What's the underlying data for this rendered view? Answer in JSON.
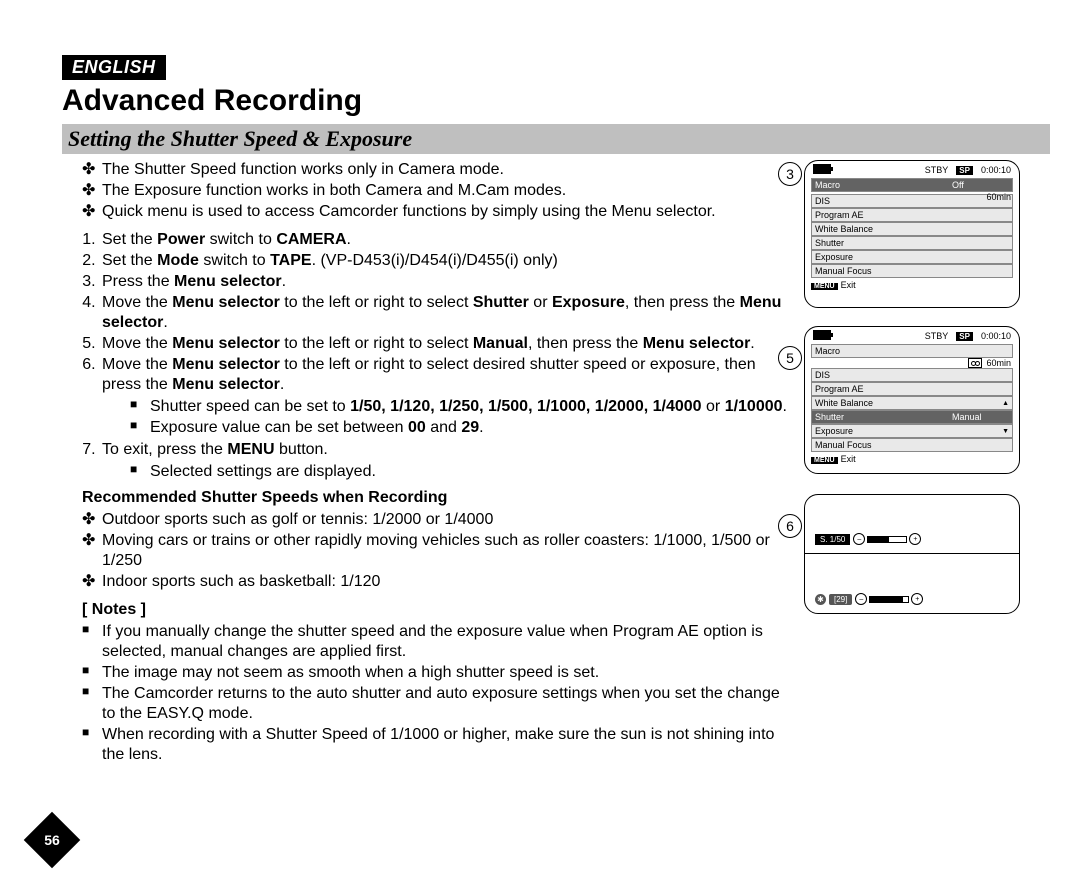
{
  "lang_tab": "ENGLISH",
  "title": "Advanced Recording",
  "section": "Setting the Shutter Speed & Exposure",
  "intro": [
    "The Shutter Speed function works only in Camera mode.",
    "The Exposure function works in both Camera and M.Cam modes.",
    "Quick menu is used to access Camcorder functions by simply using the Menu selector."
  ],
  "steps": {
    "s1_a": "Set the ",
    "s1_b": "Power",
    "s1_c": " switch to ",
    "s1_d": "CAMERA",
    "s1_e": ".",
    "s2_a": "Set the ",
    "s2_b": "Mode",
    "s2_c": " switch to ",
    "s2_d": "TAPE",
    "s2_e": ". (VP-D453(i)/D454(i)/D455(i) only)",
    "s3_a": "Press the ",
    "s3_b": "Menu selector",
    "s3_c": ".",
    "s4_a": "Move the ",
    "s4_b": "Menu selector",
    "s4_c": " to the left or right to select ",
    "s4_d": "Shutter",
    "s4_e": " or ",
    "s4_f": "Exposure",
    "s4_g": ", then press the ",
    "s4_h": "Menu selector",
    "s4_i": ".",
    "s5_a": "Move the ",
    "s5_b": "Menu selector",
    "s5_c": " to the left or right to select ",
    "s5_d": "Manual",
    "s5_e": ", then press the ",
    "s5_f": "Menu selector",
    "s5_g": ".",
    "s6_a": "Move the ",
    "s6_b": "Menu selector",
    "s6_c": " to the left or right to select desired shutter speed or exposure, then press the ",
    "s6_d": "Menu selector",
    "s6_e": ".",
    "s6_sub1_a": "Shutter speed can be set to ",
    "s6_sub1_vals": "1/50, 1/120, 1/250, 1/500, 1/1000, 1/2000, 1/4000",
    "s6_sub1_b": " or ",
    "s6_sub1_last": "1/10000",
    "s6_sub1_c": ".",
    "s6_sub2_a": "Exposure value can be set between ",
    "s6_sub2_v1": "00",
    "s6_sub2_b": " and ",
    "s6_sub2_v2": "29",
    "s6_sub2_c": ".",
    "s7_a": "To exit, press the ",
    "s7_b": "MENU",
    "s7_c": " button.",
    "s7_sub1": "Selected settings are displayed."
  },
  "rec_heading": "Recommended Shutter Speeds when Recording",
  "rec": [
    "Outdoor sports such as golf or tennis: 1/2000 or 1/4000",
    "Moving cars or trains or other rapidly moving vehicles such as roller coasters: 1/1000, 1/500 or 1/250",
    "Indoor sports such as basketball: 1/120"
  ],
  "notes_heading": "[ Notes ]",
  "notes": [
    "If you manually change the shutter speed and the exposure value when Program AE option is selected, manual changes are applied first.",
    "The image may not seem as smooth when a high shutter speed is set.",
    "The Camcorder returns to the auto shutter and auto exposure settings when you set the change to the EASY.Q mode.",
    "When recording with a Shutter Speed of 1/1000 or higher, make sure the sun is not shining into the lens."
  ],
  "page_number": "56",
  "callouts": {
    "c3": "3",
    "c5": "5",
    "c6": "6"
  },
  "lcd": {
    "stby": "STBY",
    "sp": "SP",
    "time": "0:00:10",
    "sixty": "60min",
    "macro": "Macro",
    "off": "Off",
    "dis": "DIS",
    "pae": "Program AE",
    "wb": "White Balance",
    "shutter": "Shutter",
    "exposure": "Exposure",
    "mf": "Manual Focus",
    "manual": "Manual",
    "menu": "MENU",
    "exit": "Exit",
    "s_speed": "S. 1/50",
    "exp_val": "[29]"
  }
}
